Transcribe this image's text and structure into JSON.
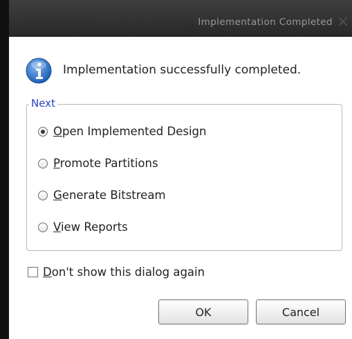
{
  "dialog": {
    "title": "Implementation Completed",
    "message": "Implementation successfully completed."
  },
  "next_group": {
    "legend": "Next",
    "options": [
      {
        "mnemonic": "O",
        "rest": "pen Implemented Design",
        "selected": true
      },
      {
        "mnemonic": "P",
        "rest": "romote Partitions",
        "selected": false
      },
      {
        "mnemonic": "G",
        "rest": "enerate Bitstream",
        "selected": false
      },
      {
        "mnemonic": "V",
        "rest": "iew Reports",
        "selected": false
      }
    ]
  },
  "dont_show": {
    "mnemonic": "D",
    "rest": "on't show this dialog again",
    "checked": false
  },
  "buttons": {
    "ok": "OK",
    "cancel": "Cancel"
  },
  "colors": {
    "legend": "#2a3fbf",
    "info_icon": "#2f73c8",
    "title_bar": "#2e2e2e"
  }
}
